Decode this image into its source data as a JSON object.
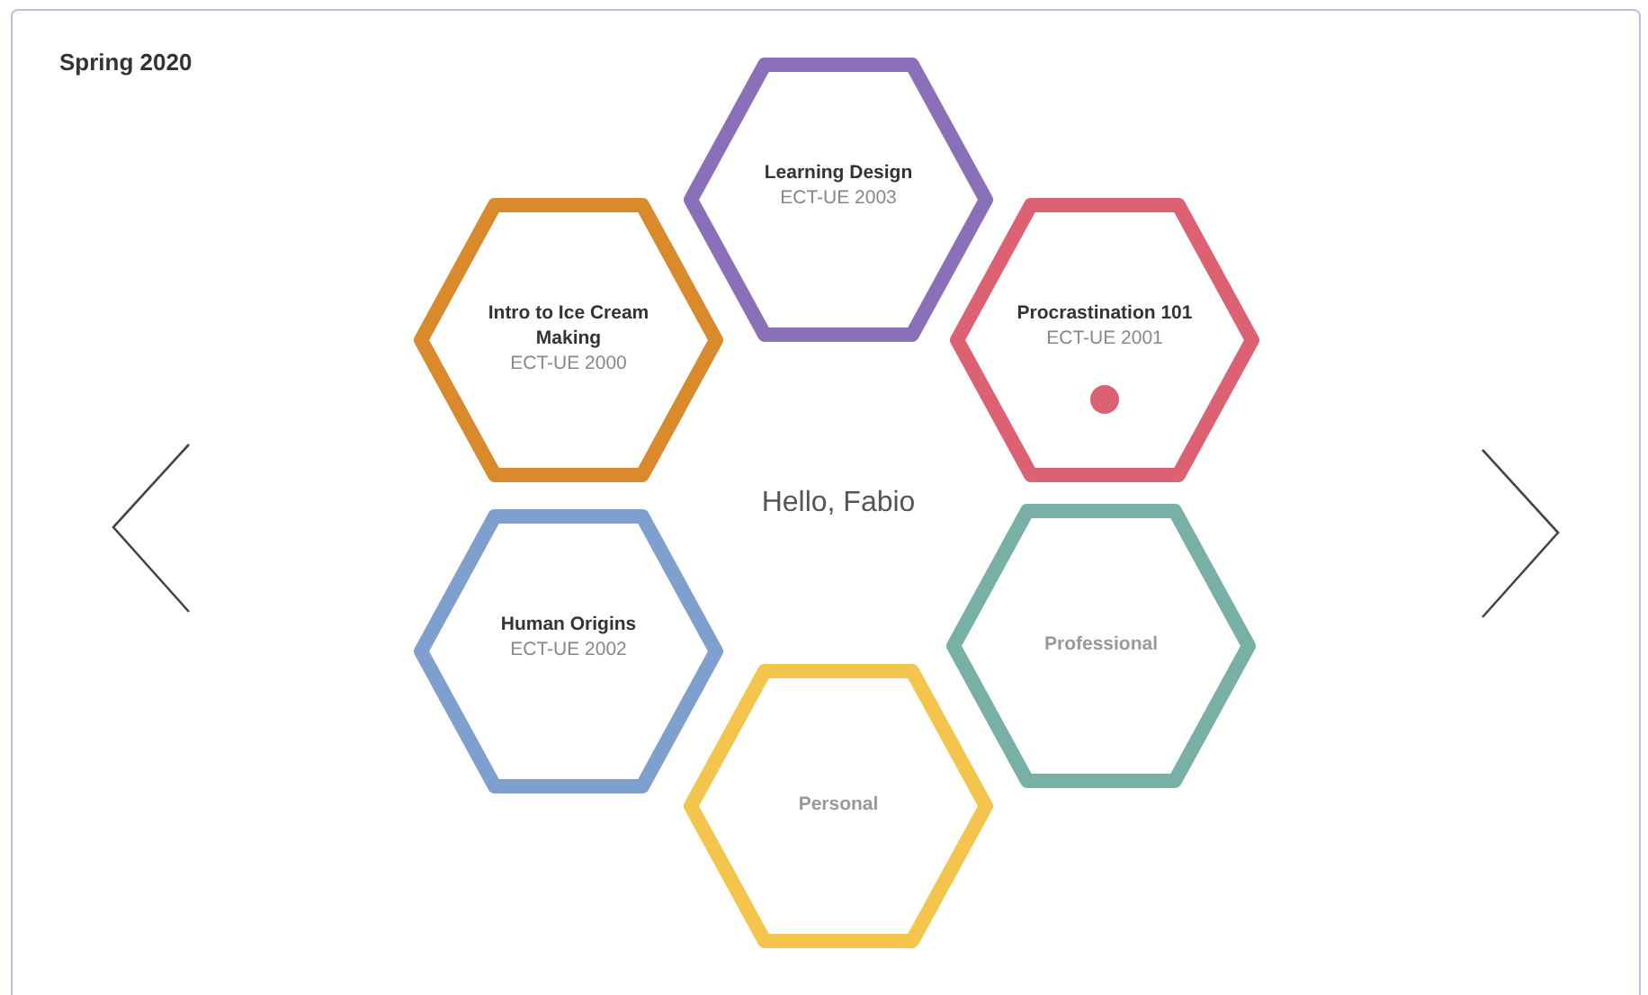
{
  "term": "Spring 2020",
  "greeting": "Hello, Fabio",
  "tiles": [
    {
      "kind": "course",
      "title": "Learning Design",
      "code": "ECT-UE 2003",
      "color": "#8a70b8",
      "notification": false
    },
    {
      "kind": "course",
      "title": "Intro to Ice Cream Making",
      "code": "ECT-UE 2000",
      "color": "#da8a2c",
      "notification": false
    },
    {
      "kind": "course",
      "title": "Procrastination 101",
      "code": "ECT-UE 2001",
      "color": "#dc6273",
      "notification": true
    },
    {
      "kind": "course",
      "title": "Human Origins",
      "code": "ECT-UE 2002",
      "color": "#7f9fcf",
      "notification": false
    },
    {
      "kind": "category",
      "title": "Professional",
      "color": "#78b0a6"
    },
    {
      "kind": "category",
      "title": "Personal",
      "color": "#f3c54d"
    }
  ]
}
